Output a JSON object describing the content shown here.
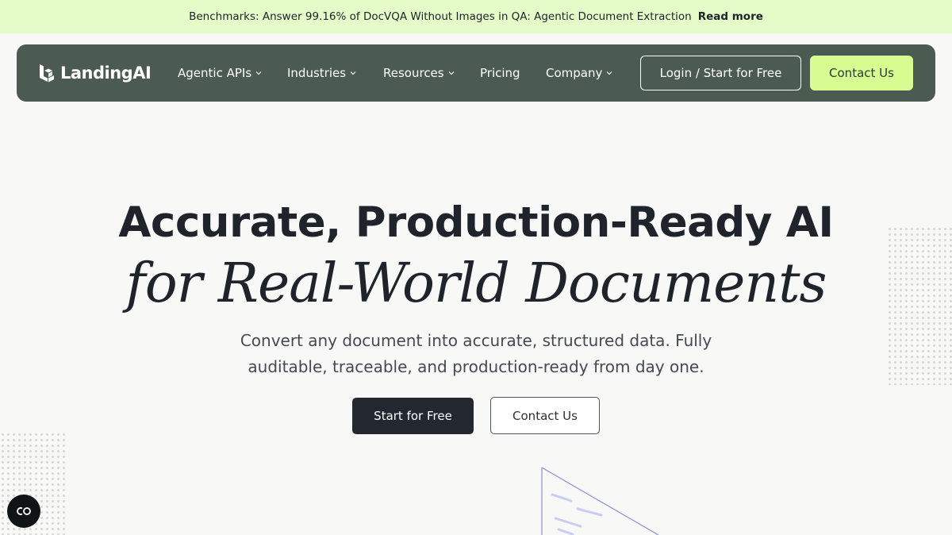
{
  "banner": {
    "text": "Benchmarks: Answer 99.16% of DocVQA Without Images in QA: Agentic Document Extraction",
    "link_label": "Read more"
  },
  "nav": {
    "logo_text": "LandingAI",
    "items": [
      {
        "label": "Agentic APIs",
        "has_dropdown": true
      },
      {
        "label": "Industries",
        "has_dropdown": true
      },
      {
        "label": "Resources",
        "has_dropdown": true
      },
      {
        "label": "Pricing",
        "has_dropdown": false
      },
      {
        "label": "Company",
        "has_dropdown": true
      }
    ],
    "login_label": "Login / Start for Free",
    "contact_label": "Contact Us"
  },
  "hero": {
    "title": "Accurate, Production-Ready AI",
    "subtitle": "for Real-World Documents",
    "description": "Convert any document into accurate, structured data. Fully auditable, traceable, and production-ready from day one.",
    "primary_cta": "Start for Free",
    "secondary_cta": "Contact Us"
  },
  "colors": {
    "banner_bg": "#e5fbc8",
    "nav_bg": "#4b5b52",
    "accent": "#d8fc91",
    "primary_button": "#232830",
    "page_bg": "#f8f8f7"
  },
  "icons": {
    "logo": "landingai-logo-icon",
    "dropdown": "chevron-down-icon",
    "fab": "co-badge-icon"
  }
}
